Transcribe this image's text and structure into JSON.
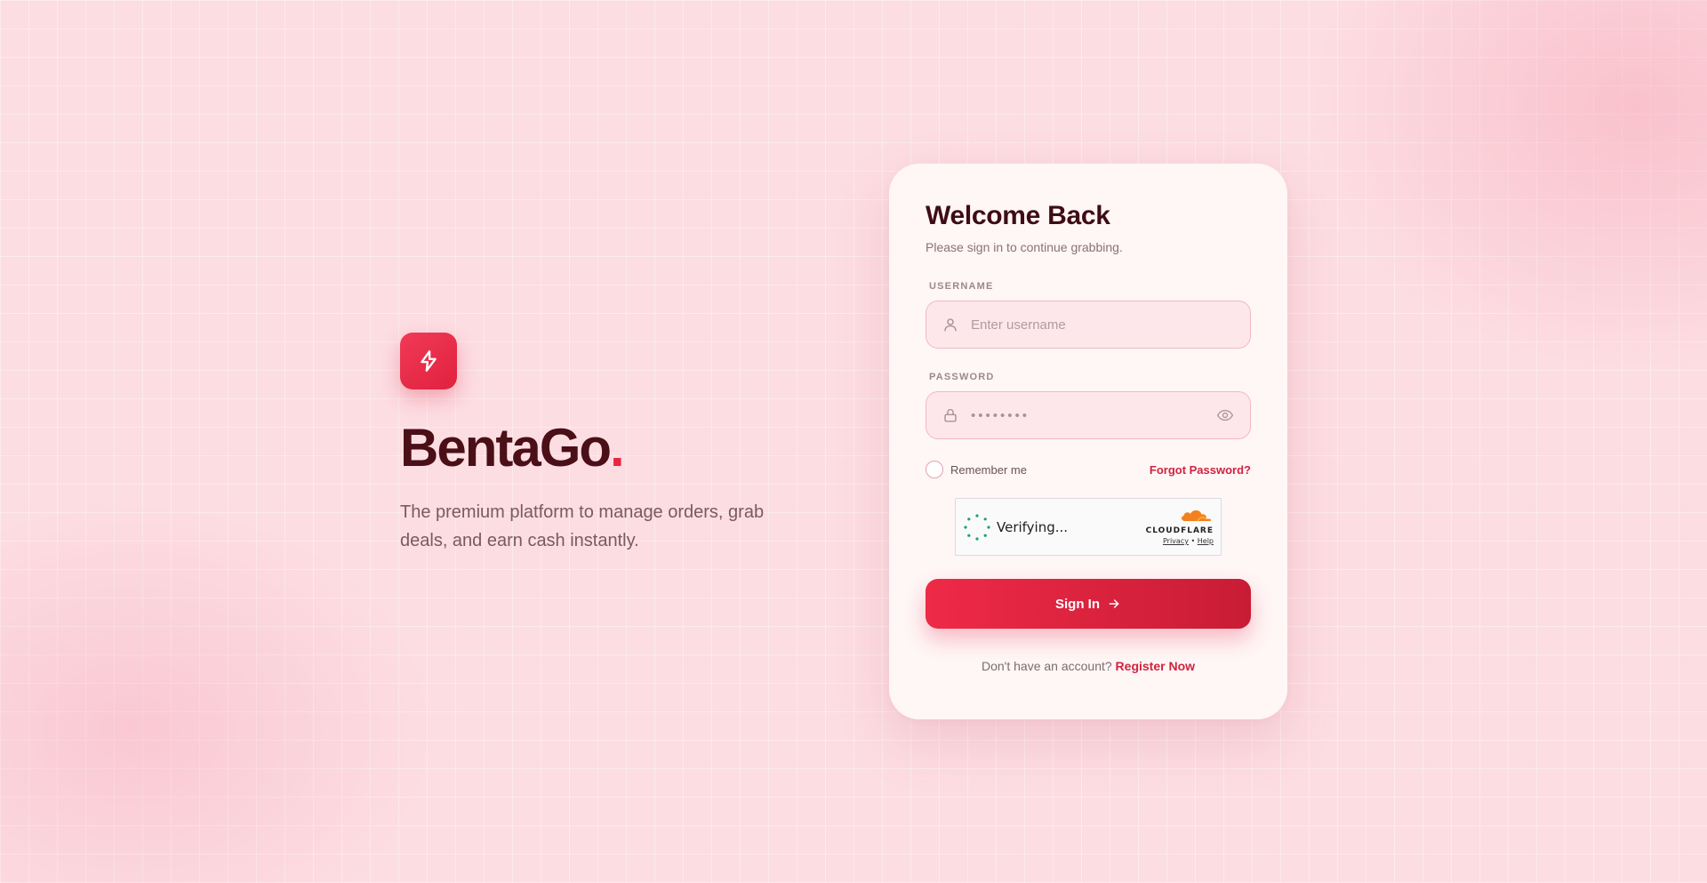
{
  "hero": {
    "brand_name": "BentaGo",
    "brand_dot": ".",
    "tagline": "The premium platform to manage orders, grab deals, and earn cash instantly.",
    "logo_icon": "lightning-bolt-icon"
  },
  "login": {
    "title": "Welcome Back",
    "subtitle": "Please sign in to continue grabbing.",
    "username": {
      "label": "USERNAME",
      "placeholder": "Enter username",
      "value": "",
      "icon": "user-icon"
    },
    "password": {
      "label": "PASSWORD",
      "placeholder": "••••••••",
      "value": "",
      "icon": "lock-icon",
      "toggle_icon": "eye-icon"
    },
    "remember_label": "Remember me",
    "remember_checked": false,
    "forgot_label": "Forgot Password?",
    "captcha": {
      "status": "Verifying...",
      "provider": "CLOUDFLARE",
      "privacy_label": "Privacy",
      "separator": "•",
      "help_label": "Help"
    },
    "signin_label": "Sign In",
    "register_prompt": "Don't have an account?",
    "register_label": "Register Now"
  },
  "colors": {
    "accent": "#e8273f",
    "brand_text": "#4a0f17",
    "background": "#fcdde2",
    "card": "#fff6f6"
  }
}
